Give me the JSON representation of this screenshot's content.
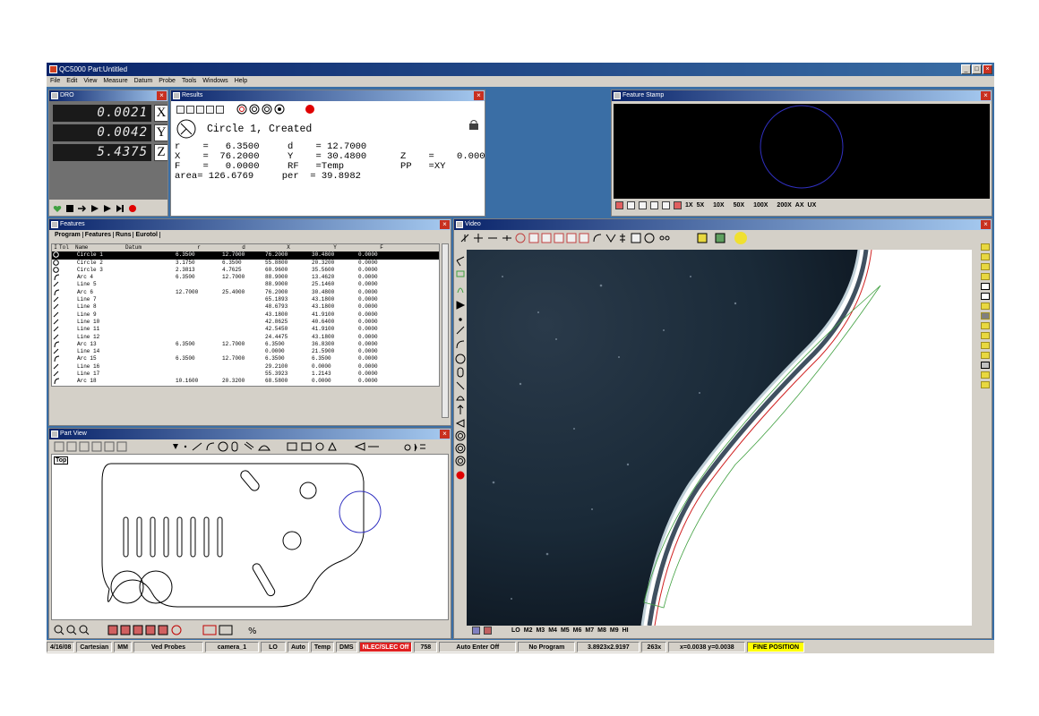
{
  "window": {
    "title": "QC5000 Part:Untitled"
  },
  "menu": [
    "File",
    "Edit",
    "View",
    "Measure",
    "Datum",
    "Probe",
    "Tools",
    "Windows",
    "Help"
  ],
  "dro": {
    "title": "DRO",
    "rows": [
      {
        "value": "0.0021",
        "axis": "X"
      },
      {
        "value": "0.0042",
        "axis": "Y"
      },
      {
        "value": "5.4375",
        "axis": "Z"
      }
    ]
  },
  "results": {
    "title": "Results",
    "feature": "Circle 1, Created",
    "lines": [
      "r    =   6.3500     d    = 12.7000",
      "X    =  76.2000     Y    = 30.4800      Z    =    0.0000",
      "F    =   0.0000     RF   =Temp          PP   =XY",
      "area= 126.6769     per  = 39.8982"
    ]
  },
  "feature_stamp": {
    "title": "Feature Stamp",
    "zooms": [
      "1X",
      "5X",
      "10X",
      "50X",
      "100X",
      "200X",
      "AX",
      "UX"
    ]
  },
  "features": {
    "title": "Features",
    "tabs": [
      "Program",
      "Features",
      "Runs",
      "Eurotol"
    ],
    "columns": [
      "I",
      "Tol",
      "Name",
      "Datum",
      "r",
      "d",
      "X",
      "Y",
      "F"
    ],
    "rows": [
      {
        "icon": "circle",
        "name": "Circle 1",
        "r": "6.3500",
        "d": "12.7000",
        "x": "76.2000",
        "y": "30.4800",
        "f": "0.0000"
      },
      {
        "icon": "circle",
        "name": "Circle 2",
        "r": "3.1750",
        "d": "6.3500",
        "x": "55.8800",
        "y": "20.3200",
        "f": "0.0000"
      },
      {
        "icon": "circle",
        "name": "Circle 3",
        "r": "2.3813",
        "d": "4.7625",
        "x": "60.9600",
        "y": "35.5600",
        "f": "0.0000"
      },
      {
        "icon": "arc",
        "name": "Arc 4",
        "r": "6.3500",
        "d": "12.7000",
        "x": "88.9000",
        "y": "13.4620",
        "f": "0.0000"
      },
      {
        "icon": "line",
        "name": "Line 5",
        "r": "",
        "d": "",
        "x": "88.9000",
        "y": "25.1460",
        "f": "0.0000"
      },
      {
        "icon": "arc",
        "name": "Arc 6",
        "r": "12.7000",
        "d": "25.4000",
        "x": "76.2000",
        "y": "30.4800",
        "f": "0.0000"
      },
      {
        "icon": "line",
        "name": "Line 7",
        "r": "",
        "d": "",
        "x": "65.1893",
        "y": "43.1800",
        "f": "0.0000"
      },
      {
        "icon": "line",
        "name": "Line 8",
        "r": "",
        "d": "",
        "x": "48.6793",
        "y": "43.1800",
        "f": "0.0000"
      },
      {
        "icon": "line",
        "name": "Line 9",
        "r": "",
        "d": "",
        "x": "43.1800",
        "y": "41.9100",
        "f": "0.0000"
      },
      {
        "icon": "line",
        "name": "Line 10",
        "r": "",
        "d": "",
        "x": "42.8625",
        "y": "40.6400",
        "f": "0.0000"
      },
      {
        "icon": "line",
        "name": "Line 11",
        "r": "",
        "d": "",
        "x": "42.5450",
        "y": "41.9100",
        "f": "0.0000"
      },
      {
        "icon": "line",
        "name": "Line 12",
        "r": "",
        "d": "",
        "x": "24.4475",
        "y": "43.1800",
        "f": "0.0000"
      },
      {
        "icon": "arc",
        "name": "Arc 13",
        "r": "6.3500",
        "d": "12.7000",
        "x": "6.3500",
        "y": "36.8300",
        "f": "0.0000"
      },
      {
        "icon": "line",
        "name": "Line 14",
        "r": "",
        "d": "",
        "x": "0.0000",
        "y": "21.5900",
        "f": "0.0000"
      },
      {
        "icon": "arc",
        "name": "Arc 15",
        "r": "6.3500",
        "d": "12.7000",
        "x": "6.3500",
        "y": "6.3500",
        "f": "0.0000"
      },
      {
        "icon": "line",
        "name": "Line 16",
        "r": "",
        "d": "",
        "x": "29.2100",
        "y": "0.0000",
        "f": "0.0000"
      },
      {
        "icon": "line",
        "name": "Line 17",
        "r": "",
        "d": "",
        "x": "55.3923",
        "y": "1.2143",
        "f": "0.0000"
      },
      {
        "icon": "arc",
        "name": "Arc 18",
        "r": "10.1600",
        "d": "20.3200",
        "x": "68.5800",
        "y": "0.0000",
        "f": "0.0000"
      }
    ]
  },
  "part_view": {
    "title": "Part View",
    "view_label": "Top"
  },
  "video": {
    "title": "Video",
    "zooms": [
      "LO",
      "M2",
      "M3",
      "M4",
      "M5",
      "M6",
      "M7",
      "M8",
      "M9",
      "HI"
    ]
  },
  "status": {
    "date": "4/16/08",
    "coords": "Cartesian",
    "units": "MM",
    "probe": "Ved Probes",
    "camera": "camera_1",
    "lo": "LO",
    "auto": "Auto",
    "temp": "Temp",
    "dms": "DMS",
    "nlec": "NLEC/SLEC Off",
    "count": "758",
    "auto_enter": "Auto Enter Off",
    "program": "No Program",
    "fov": "3.8923x2.9197",
    "mag": "263x",
    "xy": "x=0.0038 y=0.0038",
    "position": "FINE POSITION"
  },
  "colors": {
    "title_blue": "#0a246a",
    "desktop": "#3a6ea5",
    "status_red": "#e02020",
    "status_yellow": "#ffff00",
    "stamp_circle": "#3030c0"
  }
}
